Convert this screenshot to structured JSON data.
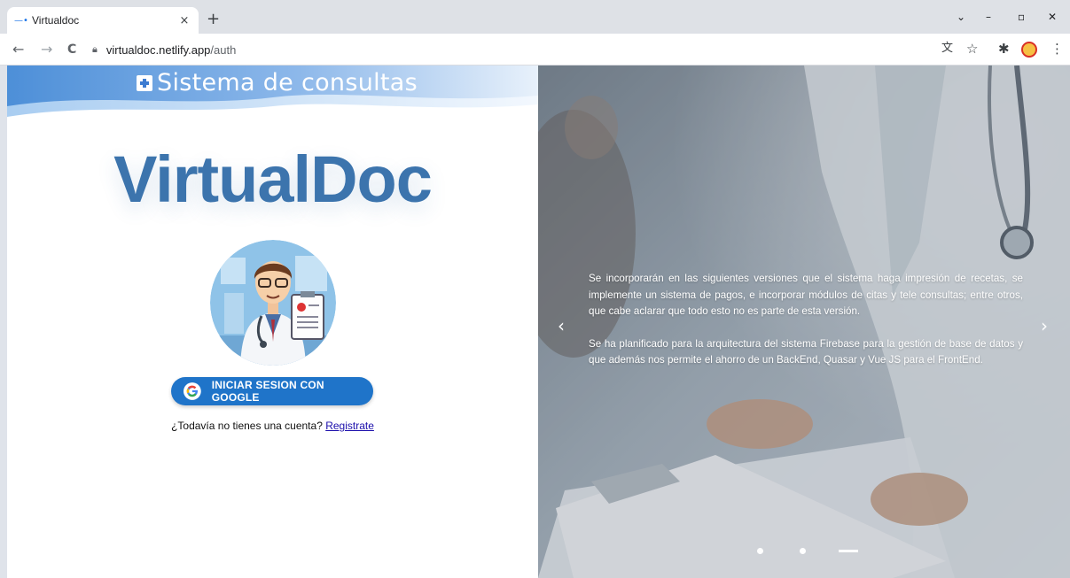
{
  "browser": {
    "tab_title": "Virtualdoc",
    "tab_close": "×",
    "new_tab": "+",
    "url_host": "virtualdoc.netlify.app",
    "url_path": "/auth",
    "minimize": "–",
    "maximize": "▫",
    "close": "✕",
    "tab_menu": "⌄",
    "back": "←",
    "forward": "→",
    "reload": "C",
    "translate_icon": "文",
    "bookmark_icon": "☆",
    "extensions_icon": "✱",
    "menu_icon": "⋮"
  },
  "header": {
    "title": "Sistema de consultas"
  },
  "brand": {
    "name": "VirtualDoc"
  },
  "auth": {
    "google_button": "INICIAR SESION CON GOOGLE",
    "signup_prompt": "¿Todavía no tienes una cuenta? ",
    "signup_link": "Registrate"
  },
  "carousel": {
    "paragraphs": [
      "Se incorporarán en las siguientes versiones que el sistema haga impresión de recetas, se implemente un sistema de pagos, e incorporar módulos de citas y tele consultas; entre otros, que cabe aclarar que todo esto no es parte de esta versión.",
      "Se ha planificado para la arquitectura del sistema Firebase para la gestión de base de datos y que además nos permite el ahorro de un BackEnd, Quasar y Vue JS para el FrontEnd."
    ],
    "prev": "‹",
    "next": "›",
    "active_slide": 3,
    "slide_count": 3
  },
  "colors": {
    "brand_blue": "#3c74ad",
    "button_blue": "#1f74c9",
    "link": "#1a0dab"
  }
}
